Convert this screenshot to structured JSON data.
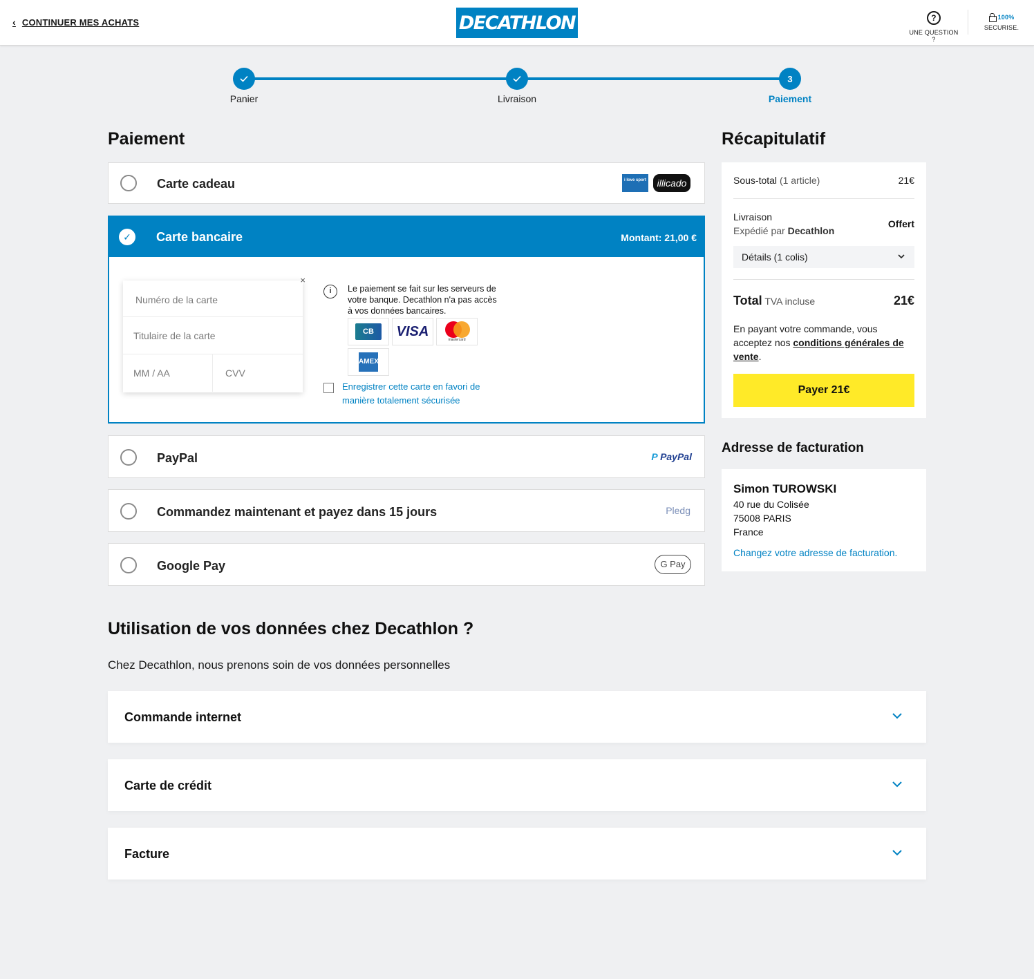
{
  "header": {
    "back_label": "CONTINUER MES ACHATS",
    "logo": "DECATHLON",
    "help_label": "UNE QUESTION ?",
    "secure_pct": "100%",
    "secure_label": "SECURISE."
  },
  "steps": [
    {
      "label": "Panier",
      "state": "done"
    },
    {
      "label": "Livraison",
      "state": "done"
    },
    {
      "label": "Paiement",
      "state": "active",
      "number": "3"
    }
  ],
  "payment": {
    "heading": "Paiement",
    "gift": {
      "label": "Carte cadeau",
      "logos": [
        "i love sport",
        "illicado"
      ]
    },
    "card": {
      "label": "Carte bancaire",
      "amount": "Montant: 21,00 €",
      "number_placeholder": "Numéro de la carte",
      "holder_placeholder": "Titulaire de la carte",
      "expiry_placeholder": "MM / AA",
      "cvv_placeholder": "CVV",
      "info": "Le paiement se fait sur les serveurs de votre banque. Decathlon n'a pas accès à vos données bancaires.",
      "brands": [
        "CB",
        "VISA",
        "mastercard",
        "AMEX"
      ],
      "save_label": "Enregistrer cette carte en favori de manière totalement sécurisée"
    },
    "paypal": {
      "label": "PayPal",
      "logo": "PayPal"
    },
    "pledg": {
      "label": "Commandez maintenant et payez dans 15 jours",
      "logo": "Pledg"
    },
    "gpay": {
      "label": "Google Pay",
      "logo": "G Pay"
    }
  },
  "summary": {
    "heading": "Récapitulatif",
    "subtotal_label": "Sous-total",
    "subtotal_count": "(1 article)",
    "subtotal_value": "21€",
    "delivery_label": "Livraison",
    "shipped_by_prefix": "Expédié par",
    "shipped_by": "Decathlon",
    "delivery_value": "Offert",
    "details_label": "Détails (1 colis)",
    "total_label": "Total",
    "total_tax": "TVA incluse",
    "total_value": "21€",
    "terms_prefix": "En payant votre commande, vous acceptez nos",
    "terms_link": "conditions générales de vente",
    "terms_suffix": ".",
    "pay_button": "Payer 21€"
  },
  "billing": {
    "heading": "Adresse de facturation",
    "name": "Simon TUROWSKI",
    "street": "40 rue du Colisée",
    "city": "75008 PARIS",
    "country": "France",
    "change_link": "Changez votre adresse de facturation."
  },
  "data_section": {
    "heading": "Utilisation de vos données chez Decathlon ?",
    "subtitle": "Chez Decathlon, nous prenons soin de vos données personnelles",
    "items": [
      {
        "label": "Commande internet"
      },
      {
        "label": "Carte de crédit"
      },
      {
        "label": "Facture"
      }
    ]
  },
  "colors": {
    "brand_blue": "#0082c3",
    "pay_yellow": "#ffea28",
    "background": "#eff0f2"
  }
}
